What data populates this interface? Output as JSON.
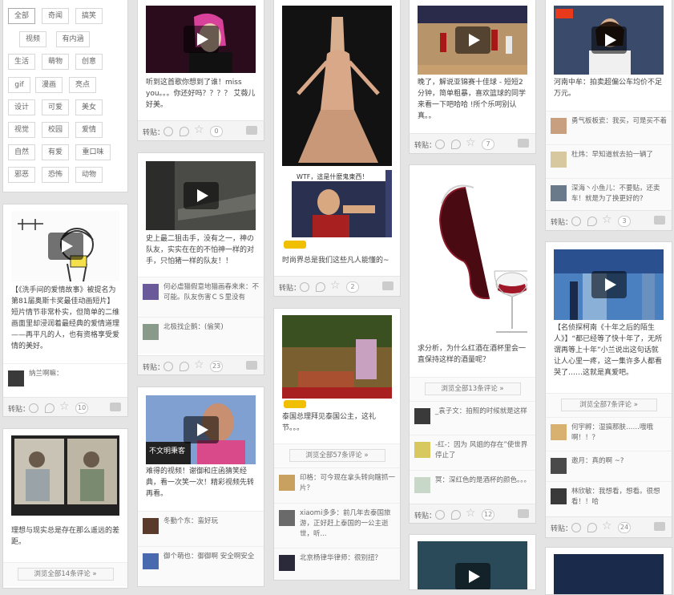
{
  "common": {
    "zhuantie": "转贴："
  },
  "tags": [
    "全部",
    "奇闻",
    "搞笑",
    "视频",
    "有内涵",
    "生活",
    "萌物",
    "创意",
    "gif",
    "漫画",
    "亮点",
    "设计",
    "可爱",
    "美女",
    "视觉",
    "校园",
    "爱情",
    "自然",
    "有爱",
    "重口味",
    "邪恶",
    "恐怖",
    "动物"
  ],
  "c1": {
    "card1": {
      "desc": "【《洗手间的爱情故事》被提名为第81届奥斯卡奖最佳动画短片】短片情节非常朴实，但简单的二维画面里却浸润着最经典的爱情道理——再平凡的人，也有资格享受爱情的美好。",
      "cmt1": "纳兰啊嘛：",
      "count": "10"
    },
    "card2": {
      "desc": "理想与现实总是存在那么遥远的差距。",
      "more": "浏览全部14条评论 »"
    }
  },
  "c2": {
    "card1": {
      "desc": "听到这首歌你想到了谁！miss you。。。你还好吗？？？？ 艾薇儿好美。",
      "count": "0"
    },
    "card2": {
      "desc": "史上最二狙击手，没有之一，神の队友，实实在在的不怕神一样的对手，只怕猪一样的队友！！",
      "cmt1": "何必虐猫假意地猫画春来来：不可能。队友伤害ＣＳ里没有",
      "cmt2": "北极找企鹅：(偷笑)",
      "count": "23"
    },
    "card3": {
      "desc": "难得的视频！谢御和庄函猜笑经典，看一次笑一次！精彩视频先转再看。",
      "cmt1": "冬勤个东：蛮好玩",
      "cmt2": "御个萌也：御御啊 安全啊安全"
    }
  },
  "c3": {
    "card1": {
      "banner": "WTF，這是什麼鬼東西！",
      "desc": "时尚界总是我们这些凡人能懂的~",
      "count": "2"
    },
    "card2": {
      "desc": "泰国总理拜见泰国公主，这礼节。。。",
      "more": "浏览全部57条评论 »",
      "cmt1": "印格：可今现在拿头转向瞎抓一片？",
      "cmt2": "xiaomi多多：前几年去泰国旅游，正好赶上泰国的一公主逝世，听...",
      "cmt3": "北京杨律华律师：很别扭？"
    }
  },
  "c4": {
    "card1": {
      "desc": "晚了，解说亚锦赛十佳球 - 短短2分钟，简单粗暴，喜欢篮球的同学来看一下吧哈哈 !所个乐呵别认真。。",
      "count": "7"
    },
    "card2": {
      "desc": "求分析，为什么红酒在酒杯里会一直保持这样的酒量呢？",
      "more": "浏览全部13条评论 »",
      "cmt1": "_袁子文：拍照的时候就是这样",
      "cmt2": "-红-：因为 风姐的存在”使世界停止了",
      "cmt3": "冥：深红色的是酒杯的颜色。。。",
      "count": "12"
    }
  },
  "c5": {
    "card1": {
      "desc": "河南中牟：拍卖超偏公车均价不足万元。",
      "cmt1": "勇气板板瓷：我买，可是买不着",
      "cmt2": "杜炜：早知道就去拍一辆了",
      "cmt3": "深海丶小鱼儿：不要贴，还卖车！就是为了换更好的?",
      "count": "3"
    },
    "card2": {
      "desc": "【名侦探柯南《十年之后的陌生人》】“都已经等了快十年了，无所谓再等上十年”小兰说出这句话就让人心里一疼，这一集许多人都看哭了……这就是真爱吧。",
      "more": "浏览全部7条评论 »",
      "cmt1": "何宇孵：湿搞那肤……哦哦啊！！？",
      "cmt2": "邀月：真的啊 ~?",
      "cmt3": "林欣敏：我想看，想看。很想看！！哈",
      "count": "24"
    }
  }
}
